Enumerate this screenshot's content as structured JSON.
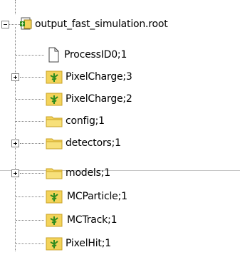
{
  "tree": {
    "root": {
      "label": "output_fast_simulation.root",
      "icon": "root-file-icon"
    },
    "items": [
      {
        "label": "ProcessID0;1",
        "icon": "document-icon",
        "expandable": false
      },
      {
        "label": "PixelCharge;3",
        "icon": "tree-icon",
        "expandable": true
      },
      {
        "label": "PixelCharge;2",
        "icon": "tree-icon",
        "expandable": false
      },
      {
        "label": "config;1",
        "icon": "folder-icon",
        "expandable": false
      },
      {
        "label": "detectors;1",
        "icon": "folder-icon",
        "expandable": true
      },
      {
        "label": "models;1",
        "icon": "folder-icon",
        "expandable": true
      },
      {
        "label": "MCParticle;1",
        "icon": "tree-icon",
        "expandable": false
      },
      {
        "label": "MCTrack;1",
        "icon": "tree-icon",
        "expandable": false
      },
      {
        "label": "PixelHit;1",
        "icon": "tree-icon",
        "expandable": false
      }
    ]
  },
  "colors": {
    "folder": "#f3d35a",
    "folder_dark": "#c9a227",
    "tree_green": "#2e8b1e",
    "line": "#808080"
  }
}
